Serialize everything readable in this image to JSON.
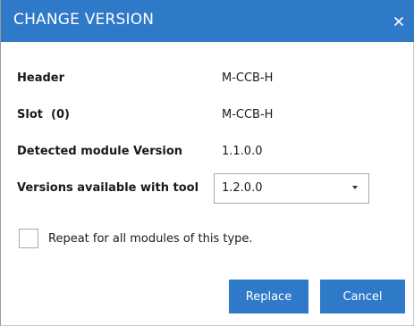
{
  "dialog": {
    "title": "CHANGE VERSION",
    "close_glyph": "×",
    "accent_color": "#2f79c9"
  },
  "fields": {
    "header_label": "Header",
    "header_value": "M-CCB-H",
    "slot_label": "Slot  (0)",
    "slot_value": "M-CCB-H",
    "detected_label": "Detected module Version",
    "detected_value": "1.1.0.0",
    "available_label": "Versions available with tool",
    "available_selected": "1.2.0.0"
  },
  "options": {
    "repeat_label": "Repeat for all modules of this type.",
    "repeat_checked": false
  },
  "buttons": {
    "replace_label": "Replace",
    "cancel_label": "Cancel"
  },
  "icons": {
    "close": "close-icon",
    "dropdown": "chevron-down-icon"
  }
}
